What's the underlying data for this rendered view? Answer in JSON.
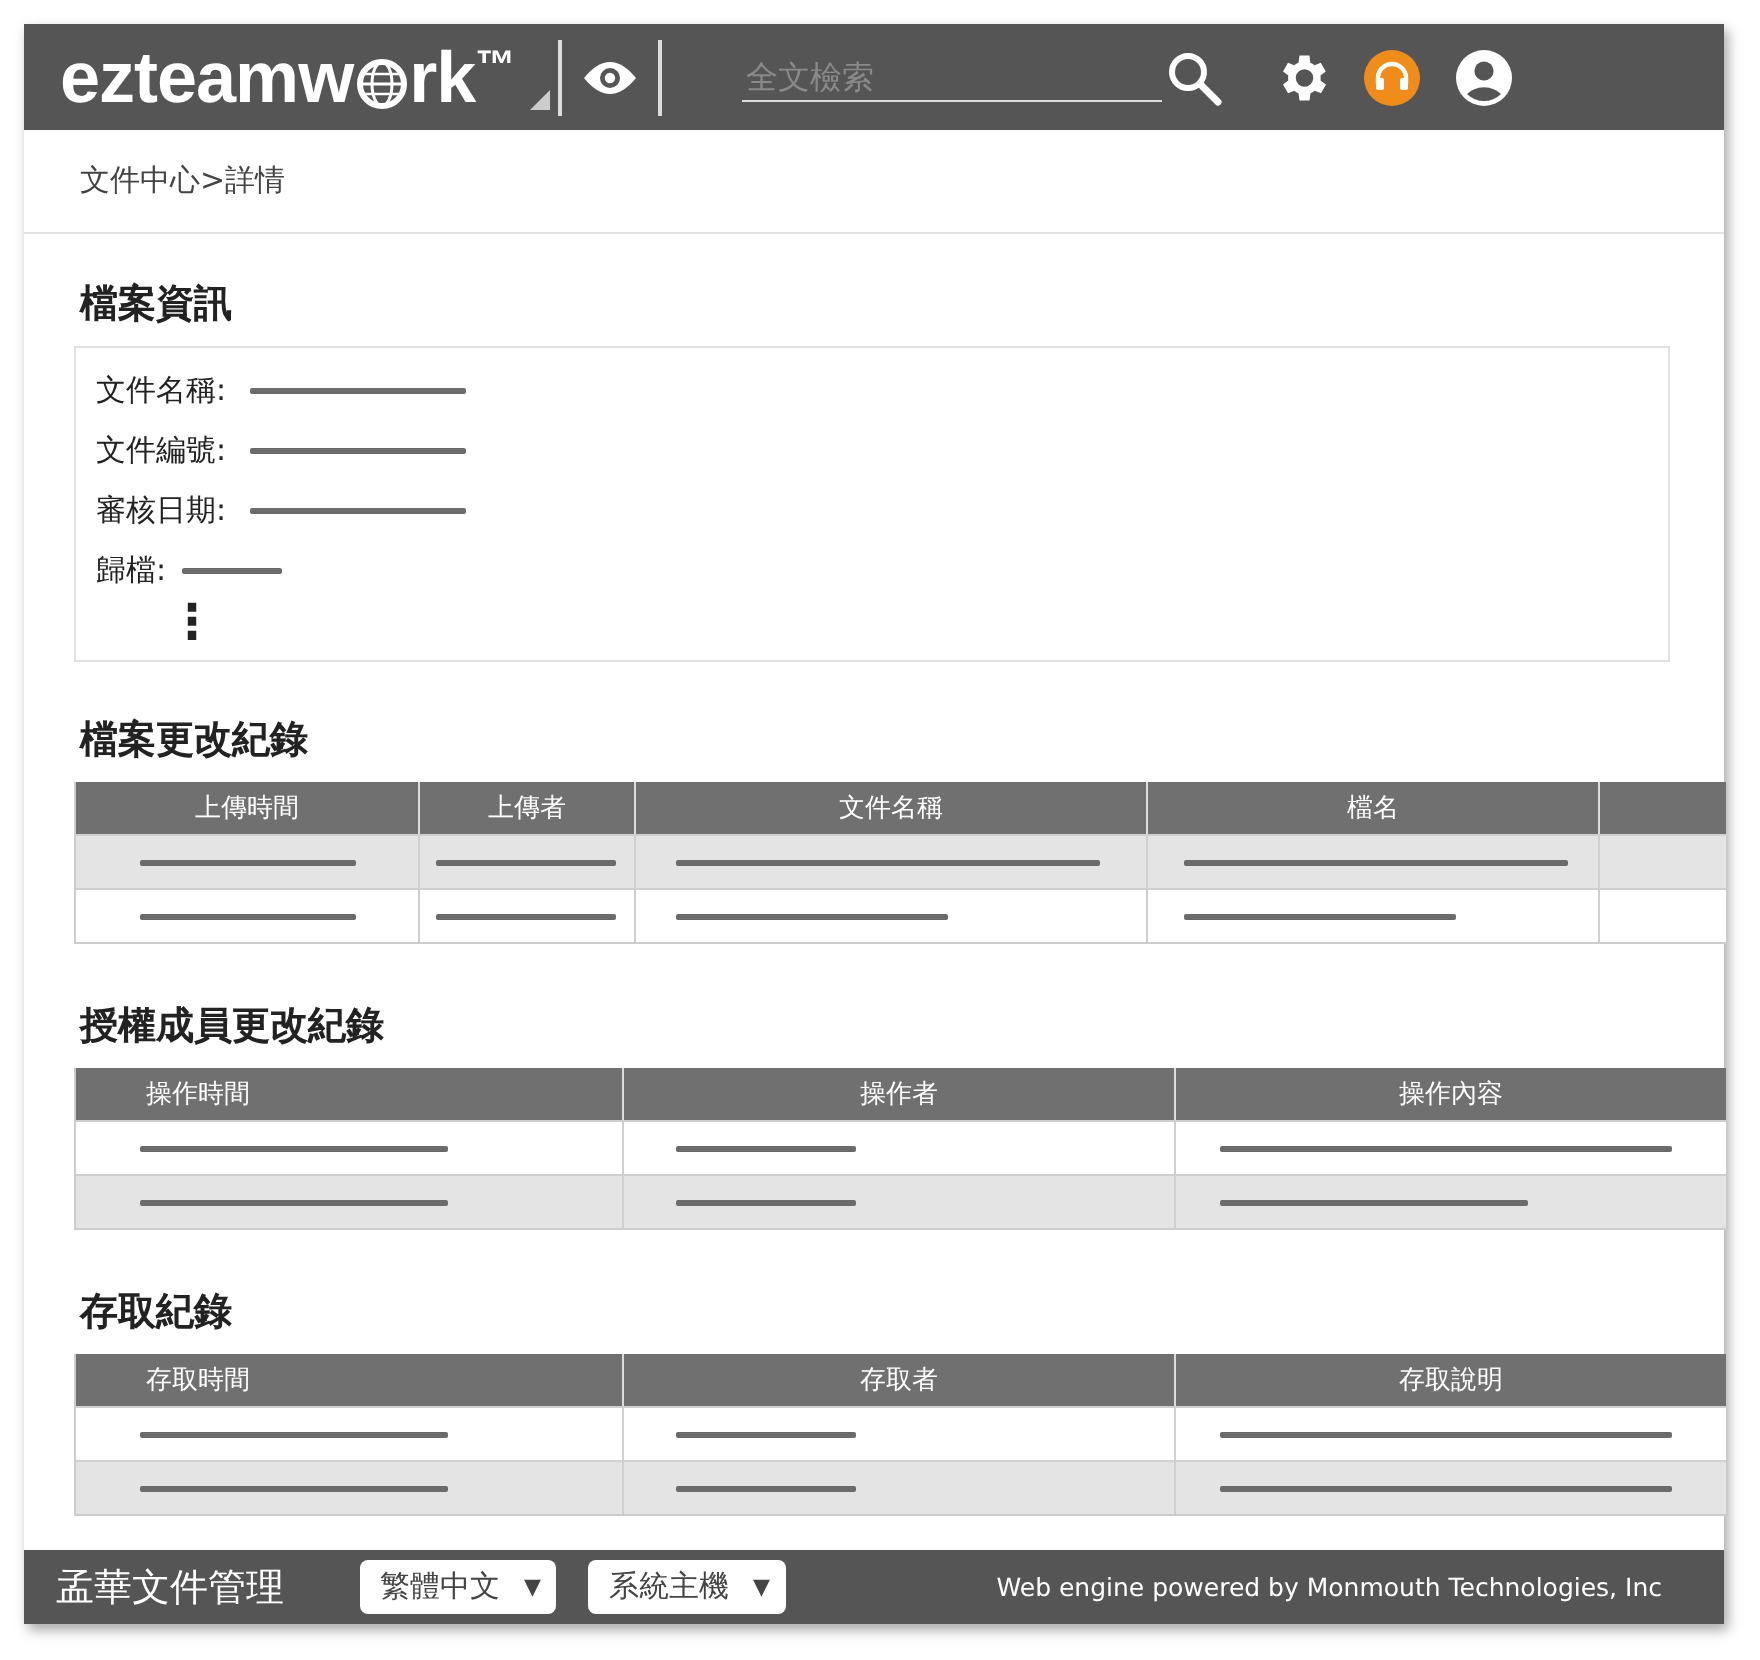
{
  "header": {
    "logo": {
      "before": "ezteamw",
      "after": "rk",
      "mark": "™"
    },
    "search": {
      "placeholder": "全文檢索"
    }
  },
  "breadcrumb": "文件中心>詳情",
  "info": {
    "title": "檔案資訊",
    "fields": [
      {
        "label": "文件名稱:",
        "kind": "long"
      },
      {
        "label": "文件編號:",
        "kind": "long"
      },
      {
        "label": "審核日期:",
        "kind": "long"
      },
      {
        "label": "歸檔:",
        "kind": "short"
      }
    ],
    "more": "⋮"
  },
  "tables": [
    {
      "title": "檔案更改紀錄",
      "columns": [
        "上傳時間",
        "上傳者",
        "文件名稱",
        "檔名",
        ""
      ],
      "rows": [
        {
          "shaded": true
        },
        {
          "shaded": false
        }
      ]
    },
    {
      "title": "授權成員更改紀錄",
      "columns": [
        "操作時間",
        "操作者",
        "操作內容"
      ],
      "rows": [
        {
          "shaded": false
        },
        {
          "shaded": true
        }
      ]
    },
    {
      "title": "存取紀錄",
      "columns": [
        "存取時間",
        "存取者",
        "存取說明"
      ],
      "rows": [
        {
          "shaded": false
        },
        {
          "shaded": true
        }
      ]
    }
  ],
  "footer": {
    "title": "孟華文件管理",
    "selects": [
      {
        "value": "繁體中文",
        "caret": "▼"
      },
      {
        "value": "系統主機",
        "caret": "▼"
      }
    ],
    "credit": "Web engine powered by Monmouth Technologies, Inc"
  }
}
